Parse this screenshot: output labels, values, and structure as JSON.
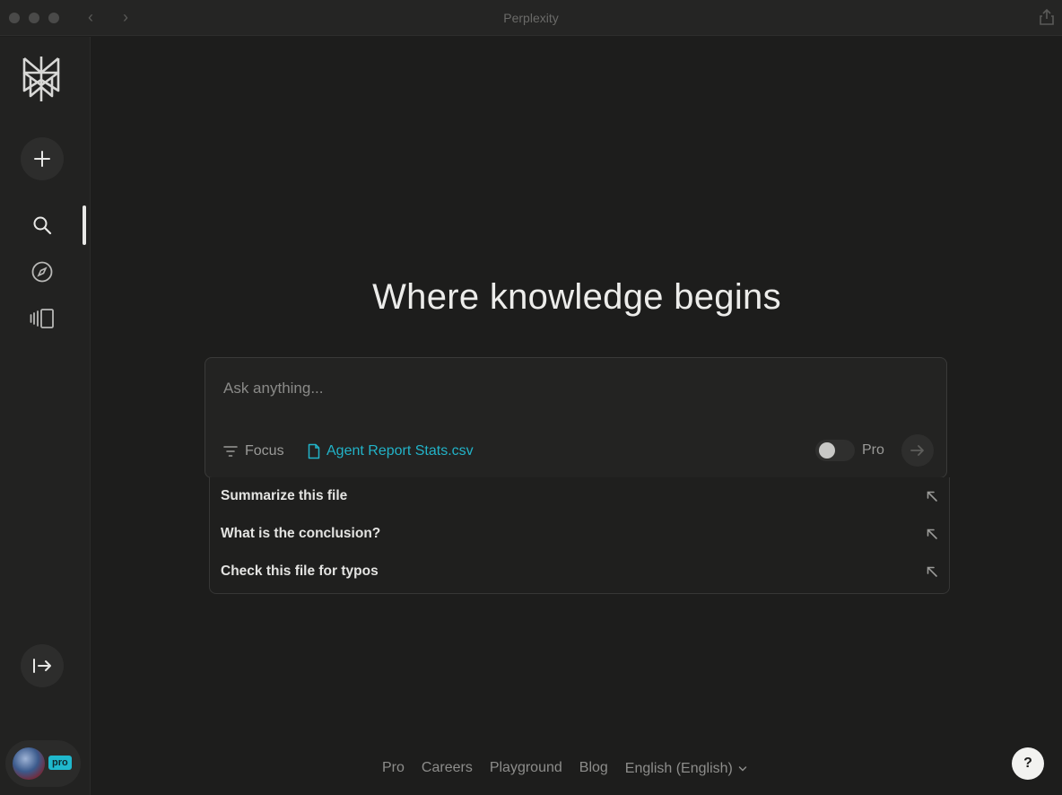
{
  "window": {
    "title": "Perplexity"
  },
  "sidebar": {
    "logo_icon": "perplexity-logo-icon",
    "new_thread_icon": "plus-icon",
    "nav": [
      {
        "name": "search",
        "icon": "search-icon",
        "active": true
      },
      {
        "name": "discover",
        "icon": "compass-icon",
        "active": false
      },
      {
        "name": "library",
        "icon": "library-icon",
        "active": false
      }
    ],
    "expand_icon": "expand-sidebar-icon",
    "account": {
      "badge": "pro"
    }
  },
  "main": {
    "headline": "Where knowledge begins",
    "ask": {
      "placeholder": "Ask anything...",
      "focus_label": "Focus",
      "attachment": "Agent Report Stats.csv",
      "pro_label": "Pro",
      "pro_enabled": false
    },
    "suggestions": [
      {
        "text": "Summarize this file"
      },
      {
        "text": "What is the conclusion?"
      },
      {
        "text": "Check this file for typos"
      }
    ]
  },
  "footer": {
    "links": [
      "Pro",
      "Careers",
      "Playground",
      "Blog",
      "English (English)"
    ]
  },
  "help": {
    "label": "?"
  },
  "colors": {
    "background": "#1d1d1c",
    "accent": "#22b3c8",
    "text": "#e8e8e6"
  }
}
